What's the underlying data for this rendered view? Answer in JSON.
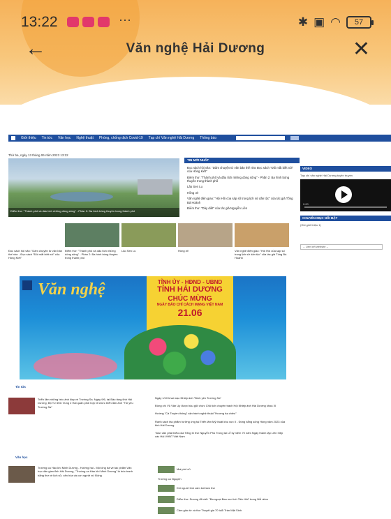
{
  "status_bar": {
    "time": "13:22",
    "more": "···",
    "battery": "57",
    "icons": [
      "bluetooth-icon",
      "vibrate-icon",
      "wifi-icon",
      "battery-icon"
    ]
  },
  "header": {
    "title": "Văn nghệ Hải Dương",
    "back_icon": "←",
    "close_icon": "✕"
  },
  "website": {
    "nav_items": [
      "Giới thiệu",
      "Tin tức",
      "Văn học",
      "Nghệ thuật",
      "Phòng, chống dịch Covid-19",
      "Tạp chí Văn nghệ Hải Dương",
      "Thông báo"
    ],
    "date_line": "Thứ ba, ngày 13 tháng 06 năm 2023 13:22",
    "hero_caption": "Điểm thơ: \"Thành phố và dấu tích những dòng sông\" - Phần 2: Ba hình bóng thuyền trong thành phố",
    "news_header": "TIN MỚI NHẤT",
    "news_items": [
      "Đọc sách hội văn: \"Dâm chuyện từ văn bản thế như Đọc sách \"Đôi mắt biết nói\" của Hồng Kiết\"",
      "Điểm thơ: \"Thành phố và dấu tích những dòng sông\" - Phần 2: Ba hình bóng thuyền trong thành phố",
      "Lão Sen Lu",
      "Hồng ơi!",
      "Văn nghệ điện giao: \"Hội Hồi của sáp số trong lịch sử dân tộc\" của tác giả Tống Bá Hoành",
      "Điểm thơ: \"Dây diết\" của tác giả Nguyễn Liên"
    ],
    "video_header": "VIDEO",
    "video_sub": "Tạp chí văn nghệ Hải Dương tuyên truyền",
    "video_time": "0:00",
    "featured_header": "CHUYÊN MỤC NỔI BẬT",
    "featured_sub": "(Ghi giới thiệu 1)",
    "select_label": "-- Liên kết website --",
    "thumbs": [
      "Đọc sách hội văn: \"Dâm chuyện từ văn bản thế như - Đọc sách \"Đôi mắt biết nói\" của Hồng Kiết\"",
      "Điểm thơ: \"Thành phố và dấu tích những dòng sông\" - Phần 2: Ba hình bóng thuyền trong thành phố",
      "Lão Sen Lu",
      "Hồng ơi!",
      "Văn nghệ điện giao: \"Hội Hồi của sáp số trong lịch sử dân tộc\" của tác giả Tống Bá Hoành"
    ],
    "banner": {
      "brand": "Văn nghệ",
      "line1": "TỈNH ỦY - HĐND - UBND",
      "line2": "TỈNH HẢI DƯƠNG",
      "line3": "CHÚC MỪNG",
      "line4": "NGÀY BÁO CHÍ CÁCH MẠNG VIỆT NAM",
      "line5": "21.06"
    },
    "section1": {
      "label": "Tin tức",
      "main_article": "Triển lãm những bức ảnh đẹp về Trường Sa. Ngày 9/6, tại Bảo tàng tỉnh Hải Dương, Bộ Tư lệnh Vùng 2 Hải quân phối hợp tổ chức triển lãm ảnh \"Tôi yêu Trường Sa\"",
      "list": [
        "Ngày 1/10 khai mạc Nhiếp ảnh \"Bình yên Trường Sa\"",
        "Đồng chí Vũ Văn Uy được bầu giữ chức Chủ tịch chuyên trách Hội Nhiếp ảnh Hải Dương khoá XI",
        "Hướng \"Cá Truyền thống\" vận hành nghệ thuật \"Hương hạ chiều\"",
        "Ranh sách tác phẩm hưởng ứng tại Triển lãm Mỹ thuật khu vực II - Đồng bằng sông Hồng năm 2023 của tỉnh Hải Dương",
        "Toàn văn phát biểu của Tổng bí thư Nguyễn Phú Trọng tại Lễ kỷ niệm 70 năm Ngày thành lập Liên hiệp các Hội VHNT Việt Nam"
      ]
    },
    "section2": {
      "label": "Văn học",
      "main_article": "Trường ca Hào khí Minh Dương - Hướng hai - Một ông bà về tác phẩm Văn học dân gian tỉnh Hải Dương, \"Trường ca Hào khí Minh Dương\" là bức tranh bằng thơ về lịch sử, văn hóa và con người xứ Đông",
      "list": [
        "Mai phố cũ",
        "Trường ca Nguyện",
        "Khi người lính cầm bút làm thơ",
        "Điểm thơ: Dương đã viết: \"Ba ngoại Bao mơ tình Tiên Hải\" trong Nỗi niềm",
        "Cảm giác từ và thơ Thuyết gia 70 tuổi Trần Mặt Sinh"
      ]
    }
  }
}
